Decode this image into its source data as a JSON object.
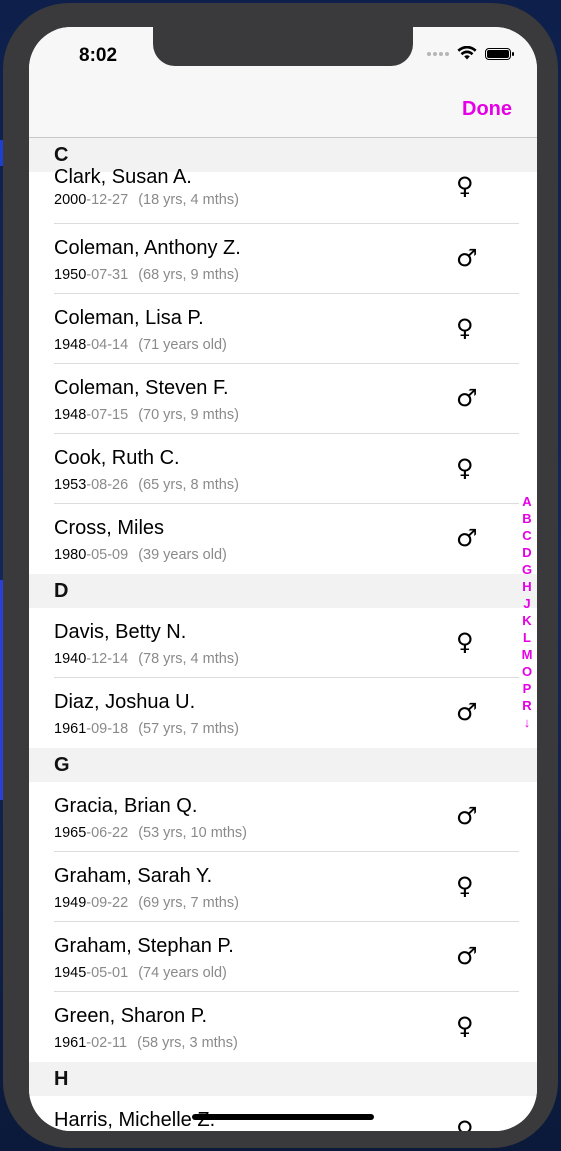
{
  "status_bar": {
    "time": "8:02"
  },
  "navbar": {
    "done_label": "Done"
  },
  "colors": {
    "accent": "#e600e6"
  },
  "icons": {
    "female": "♀",
    "male": "♂",
    "index_down_arrow": "↓"
  },
  "sections": [
    {
      "letter": "C",
      "rows": [
        {
          "name": "Clark, Susan A.",
          "year": "2000",
          "date_rest": "-12-27",
          "age": "(18 yrs, 4 mths)",
          "gender": "♀"
        },
        {
          "name": "Coleman, Anthony Z.",
          "year": "1950",
          "date_rest": "-07-31",
          "age": "(68 yrs, 9 mths)",
          "gender": "♂"
        },
        {
          "name": "Coleman, Lisa P.",
          "year": "1948",
          "date_rest": "-04-14",
          "age": "(71 years old)",
          "gender": "♀"
        },
        {
          "name": "Coleman, Steven F.",
          "year": "1948",
          "date_rest": "-07-15",
          "age": "(70 yrs, 9 mths)",
          "gender": "♂"
        },
        {
          "name": "Cook, Ruth C.",
          "year": "1953",
          "date_rest": "-08-26",
          "age": "(65 yrs, 8 mths)",
          "gender": "♀"
        },
        {
          "name": "Cross, Miles",
          "year": "1980",
          "date_rest": "-05-09",
          "age": "(39 years old)",
          "gender": "♂"
        }
      ]
    },
    {
      "letter": "D",
      "rows": [
        {
          "name": "Davis, Betty N.",
          "year": "1940",
          "date_rest": "-12-14",
          "age": "(78 yrs, 4 mths)",
          "gender": "♀"
        },
        {
          "name": "Diaz, Joshua U.",
          "year": "1961",
          "date_rest": "-09-18",
          "age": "(57 yrs, 7 mths)",
          "gender": "♂"
        }
      ]
    },
    {
      "letter": "G",
      "rows": [
        {
          "name": "Gracia, Brian Q.",
          "year": "1965",
          "date_rest": "-06-22",
          "age": "(53 yrs, 10 mths)",
          "gender": "♂"
        },
        {
          "name": "Graham, Sarah Y.",
          "year": "1949",
          "date_rest": "-09-22",
          "age": "(69 yrs, 7 mths)",
          "gender": "♀"
        },
        {
          "name": "Graham, Stephan P.",
          "year": "1945",
          "date_rest": "-05-01",
          "age": "(74 years old)",
          "gender": "♂"
        },
        {
          "name": "Green, Sharon P.",
          "year": "1961",
          "date_rest": "-02-11",
          "age": "(58 yrs, 3 mths)",
          "gender": "♀"
        }
      ]
    },
    {
      "letter": "H",
      "rows": [
        {
          "name": "Harris, Michelle Z.",
          "year": "",
          "date_rest": "",
          "age": "",
          "gender": "♀"
        }
      ]
    }
  ],
  "index_letters": [
    "A",
    "B",
    "C",
    "D",
    "G",
    "H",
    "J",
    "K",
    "L",
    "M",
    "O",
    "P",
    "R",
    "↓"
  ]
}
